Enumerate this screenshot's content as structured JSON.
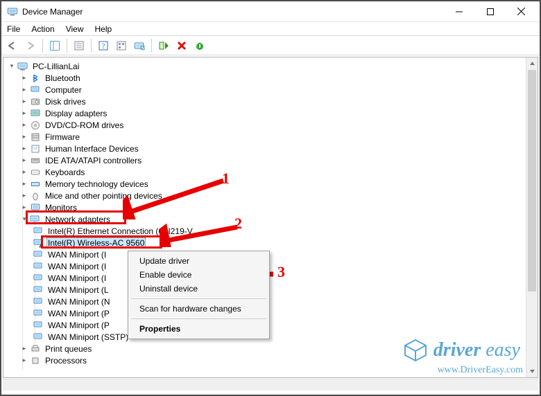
{
  "window": {
    "title": "Device Manager",
    "controls": {
      "min": "Minimize",
      "max": "Maximize",
      "close": "Close"
    }
  },
  "menu": {
    "file": "File",
    "action": "Action",
    "view": "View",
    "help": "Help"
  },
  "tree": {
    "root": "PC-LillianLai",
    "items": [
      "Bluetooth",
      "Computer",
      "Disk drives",
      "Display adapters",
      "DVD/CD-ROM drives",
      "Firmware",
      "Human Interface Devices",
      "IDE ATA/ATAPI controllers",
      "Keyboards",
      "Memory technology devices",
      "Mice and other pointing devices",
      "Monitors"
    ],
    "network_adapters_label": "Network adapters",
    "network_children": [
      "Intel(R) Ethernet Connection (6) I219-V",
      "Intel(R) Wireless-AC 9560",
      "WAN Miniport (I",
      "WAN Miniport (I",
      "WAN Miniport (I",
      "WAN Miniport (L",
      "WAN Miniport (N",
      "WAN Miniport (P",
      "WAN Miniport (P",
      "WAN Miniport (SSTP)"
    ],
    "after": [
      "Print queues",
      "Processors"
    ]
  },
  "contextmenu": {
    "update": "Update driver",
    "enable": "Enable device",
    "uninstall": "Uninstall device",
    "scan": "Scan for hardware changes",
    "properties": "Properties"
  },
  "annotations": {
    "n1": "1",
    "n2": "2",
    "n3": "3"
  },
  "brand": {
    "text1": "driver",
    "text2": "easy",
    "url": "www.DriverEasy.com"
  }
}
